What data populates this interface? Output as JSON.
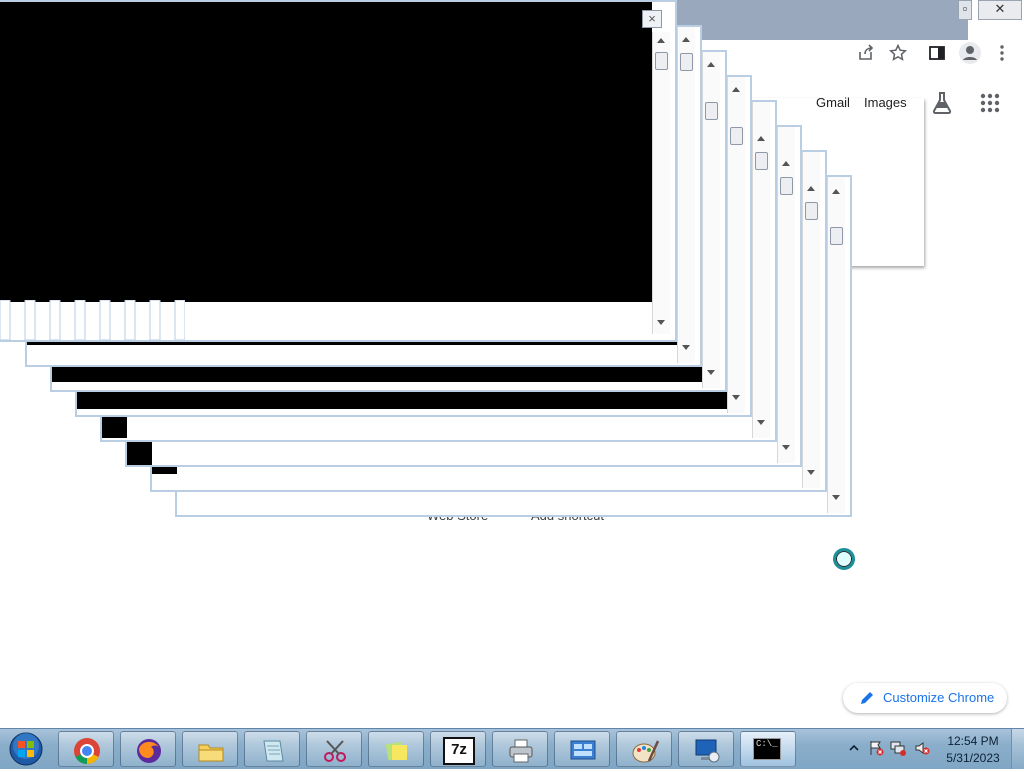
{
  "chrome": {
    "gmail_label": "Gmail",
    "images_label": "Images",
    "shortcut_webstore": "Web Store",
    "shortcut_add": "Add shortcut",
    "customize_label": "Customize Chrome",
    "accent_color": "#1a73e8"
  },
  "dialog": {
    "close_glyph": "×"
  },
  "taskbar": {
    "apps": [
      {
        "name": "Google Chrome",
        "icon": "chrome-icon"
      },
      {
        "name": "Firefox",
        "icon": "firefox-icon"
      },
      {
        "name": "Windows Explorer",
        "icon": "folder-icon"
      },
      {
        "name": "Notepad-like editor",
        "icon": "notepad-icon"
      },
      {
        "name": "Snipping Tool",
        "icon": "scissors-icon"
      },
      {
        "name": "Sticky Notes",
        "icon": "sticky-notes-icon"
      },
      {
        "name": "7-Zip",
        "icon": "7zip-icon",
        "text": "7z"
      },
      {
        "name": "Printer",
        "icon": "printer-icon"
      },
      {
        "name": "Control Panel",
        "icon": "control-panel-icon"
      },
      {
        "name": "Paint",
        "icon": "paint-icon"
      },
      {
        "name": "Remote Desktop",
        "icon": "remote-desktop-icon"
      },
      {
        "name": "Command Prompt",
        "icon": "cmd-icon",
        "text": "C:\\_"
      }
    ],
    "clock_time": "12:54 PM",
    "clock_date": "5/31/2023"
  }
}
